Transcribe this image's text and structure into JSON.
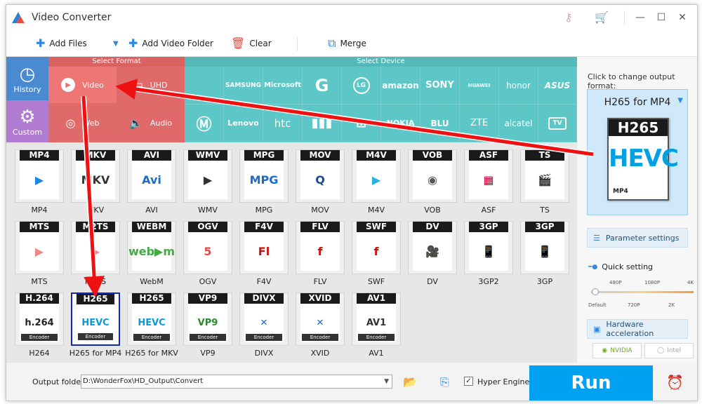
{
  "app": {
    "title": "Video Converter"
  },
  "toolbar": {
    "add_files": "Add Files",
    "add_video_folder": "Add Video Folder",
    "clear": "Clear",
    "merge": "Merge"
  },
  "headers": {
    "select_format": "Select Format",
    "select_device": "Select Device"
  },
  "categories": [
    {
      "label": "History"
    },
    {
      "label": "Video"
    },
    {
      "label": "UHD"
    },
    {
      "label": "Custom"
    },
    {
      "label": "Web"
    },
    {
      "label": "Audio"
    }
  ],
  "devices_row1": [
    "",
    "SAMSUNG",
    "Microsoft",
    "G",
    "LG",
    "amazon",
    "SONY",
    "HUAWEI",
    "honor",
    "ASUS"
  ],
  "devices_row2": [
    "",
    "Lenovo",
    "htc",
    "",
    "",
    "NOKIA",
    "BLU",
    "ZTE",
    "alcatel",
    "TV"
  ],
  "formats": [
    {
      "tag": "MP4",
      "name": "MP4",
      "art": "▶"
    },
    {
      "tag": "MKV",
      "name": "MKV",
      "art": "MKV"
    },
    {
      "tag": "AVI",
      "name": "AVI",
      "art": "Avi"
    },
    {
      "tag": "WMV",
      "name": "WMV",
      "art": "▶"
    },
    {
      "tag": "MPG",
      "name": "MPG",
      "art": "MPG"
    },
    {
      "tag": "MOV",
      "name": "MOV",
      "art": "Q"
    },
    {
      "tag": "M4V",
      "name": "M4V",
      "art": "▶"
    },
    {
      "tag": "VOB",
      "name": "VOB",
      "art": "◉"
    },
    {
      "tag": "ASF",
      "name": "ASF",
      "art": "▦"
    },
    {
      "tag": "TS",
      "name": "TS",
      "art": "🎬"
    },
    {
      "tag": "MTS",
      "name": "MTS",
      "art": "▶"
    },
    {
      "tag": "M2TS",
      "name": "M2TS",
      "art": "▶"
    },
    {
      "tag": "WEBM",
      "name": "WebM",
      "art": "web▶m"
    },
    {
      "tag": "OGV",
      "name": "OGV",
      "art": "5"
    },
    {
      "tag": "F4V",
      "name": "F4V",
      "art": "Fl"
    },
    {
      "tag": "FLV",
      "name": "FLV",
      "art": "f"
    },
    {
      "tag": "SWF",
      "name": "SWF",
      "art": "f"
    },
    {
      "tag": "DV",
      "name": "DV",
      "art": "🎥"
    },
    {
      "tag": "3GP",
      "name": "3GP2",
      "art": "📱"
    },
    {
      "tag": "3GP",
      "name": "3GP",
      "art": "📱"
    },
    {
      "tag": "H.264",
      "name": "H264",
      "art": "h.264",
      "enc": "Encoder"
    },
    {
      "tag": "H265",
      "name": "H265 for MP4",
      "art": "HEVC",
      "enc": "Encoder"
    },
    {
      "tag": "H265",
      "name": "H265 for MKV",
      "art": "HEVC",
      "enc": "Encoder"
    },
    {
      "tag": "VP9",
      "name": "VP9",
      "art": "VP9",
      "enc": "Encoder"
    },
    {
      "tag": "DIVX",
      "name": "DIVX",
      "art": "✕",
      "enc": "Encoder"
    },
    {
      "tag": "XVID",
      "name": "XVID",
      "art": "✕",
      "enc": "Encoder"
    },
    {
      "tag": "AV1",
      "name": "AV1",
      "art": "AV1",
      "enc": "Encoder"
    }
  ],
  "right": {
    "hint": "Click to change output format:",
    "current_format": "H265 for MP4",
    "preview_top": "H265",
    "preview_mid": "HEVC",
    "preview_sub": "MP4",
    "param_settings": "Parameter settings",
    "quick_setting": "Quick setting",
    "quality_top": [
      "480P",
      "1080P",
      "4K"
    ],
    "quality_bottom": [
      "Default",
      "720P",
      "2K"
    ],
    "hw_accel": "Hardware acceleration",
    "nvidia": "NVIDIA",
    "intel": "Intel"
  },
  "bottom": {
    "output_label": "Output folder:",
    "output_path": "D:\\WonderFox\\HD_Output\\Convert",
    "hyper_engine": "Hyper Engine",
    "run": "Run"
  },
  "colors": {
    "accent": "#00a1f0",
    "device_teal": "#5cc7c6",
    "video_red": "#e8706f",
    "history_blue": "#4a8ad1",
    "custom_purple": "#b07bd1"
  }
}
